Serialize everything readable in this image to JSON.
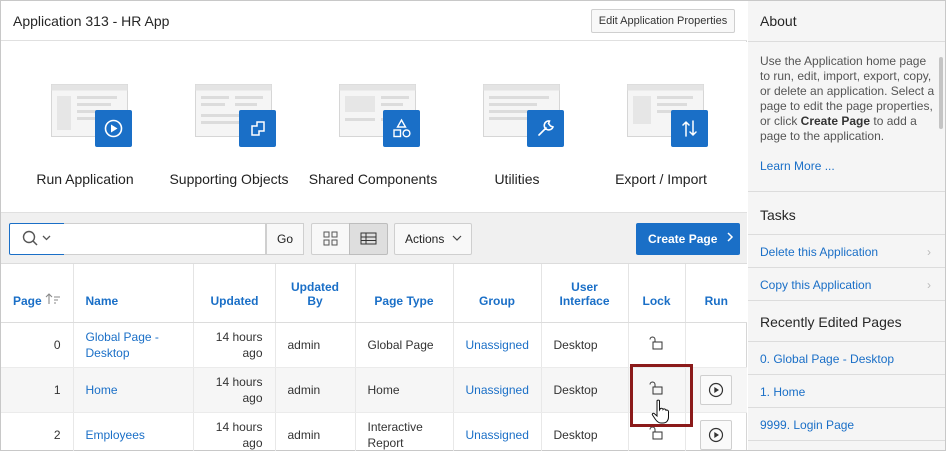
{
  "header": {
    "title": "Application 313 - HR App",
    "edit_props_label": "Edit Application Properties"
  },
  "tiles": [
    {
      "label": "Run Application",
      "icon": "play-icon"
    },
    {
      "label": "Supporting Objects",
      "icon": "install-icon"
    },
    {
      "label": "Shared Components",
      "icon": "shapes-icon"
    },
    {
      "label": "Utilities",
      "icon": "wrench-icon"
    },
    {
      "label": "Export / Import",
      "icon": "transfer-icon"
    }
  ],
  "toolbar": {
    "search_value": "",
    "go_label": "Go",
    "actions_label": "Actions",
    "create_page_label": "Create Page"
  },
  "table": {
    "headers": {
      "page": "Page",
      "name": "Name",
      "updated": "Updated",
      "updated_by_1": "Updated",
      "updated_by_2": "By",
      "page_type": "Page Type",
      "group": "Group",
      "ui_1": "User",
      "ui_2": "Interface",
      "lock": "Lock",
      "run": "Run"
    },
    "rows": [
      {
        "page": "0",
        "name_1": "Global Page -",
        "name_2": "Desktop",
        "updated_1": "14 hours",
        "updated_2": "ago",
        "by": "admin",
        "type_1": "Global Page",
        "type_2": "",
        "group": "Unassigned",
        "ui": "Desktop"
      },
      {
        "page": "1",
        "name_1": "Home",
        "name_2": "",
        "updated_1": "14 hours",
        "updated_2": "ago",
        "by": "admin",
        "type_1": "Home",
        "type_2": "",
        "group": "Unassigned",
        "ui": "Desktop"
      },
      {
        "page": "2",
        "name_1": "Employees",
        "name_2": "",
        "updated_1": "14 hours",
        "updated_2": "ago",
        "by": "admin",
        "type_1": "Interactive",
        "type_2": "Report",
        "group": "Unassigned",
        "ui": "Desktop"
      }
    ]
  },
  "side": {
    "about_title": "About",
    "about_text_1": "Use the Application home page to run, edit, import, export, copy, or delete an application. Select a page to edit the page properties, or click ",
    "about_text_bold": "Create Page",
    "about_text_2": " to add a page to the application.",
    "learn_more": "Learn More ...",
    "tasks_title": "Tasks",
    "tasks": [
      "Delete this Application",
      "Copy this Application"
    ],
    "recent_title": "Recently Edited Pages",
    "recent": [
      "0. Global Page - Desktop",
      "1. Home",
      "9999. Login Page"
    ]
  },
  "colors": {
    "accent": "#1a6fc7",
    "highlight_box": "#8b1a1a"
  }
}
